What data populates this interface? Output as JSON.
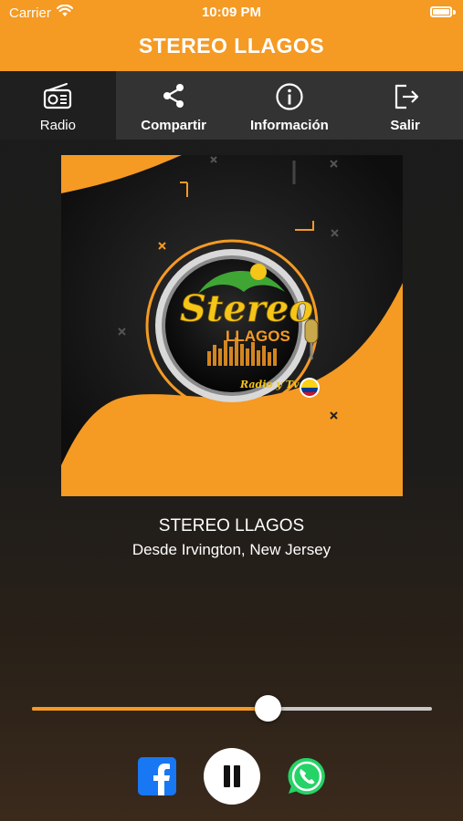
{
  "status_bar": {
    "carrier": "Carrier",
    "time": "10:09 PM"
  },
  "header": {
    "title": "STEREO LLAGOS"
  },
  "tabs": [
    {
      "label": "Radio",
      "icon": "radio-icon",
      "active": true
    },
    {
      "label": "Compartir",
      "icon": "share-icon",
      "active": false
    },
    {
      "label": "Información",
      "icon": "info-icon",
      "active": false
    },
    {
      "label": "Salir",
      "icon": "exit-icon",
      "active": false
    }
  ],
  "artwork": {
    "logo_text": "Stereo",
    "logo_subtext": "LLAGOS",
    "logo_tagline": "Radio y Tv"
  },
  "now_playing": {
    "name": "STEREO LLAGOS",
    "location": "Desde Irvington, New Jersey"
  },
  "volume": {
    "level": 0.59
  },
  "colors": {
    "accent": "#f59a23",
    "tabbar": "#333333",
    "facebook": "#1877f2",
    "whatsapp": "#25d366"
  },
  "controls": {
    "facebook": "facebook-icon",
    "pause": "pause-icon",
    "whatsapp": "whatsapp-icon"
  }
}
